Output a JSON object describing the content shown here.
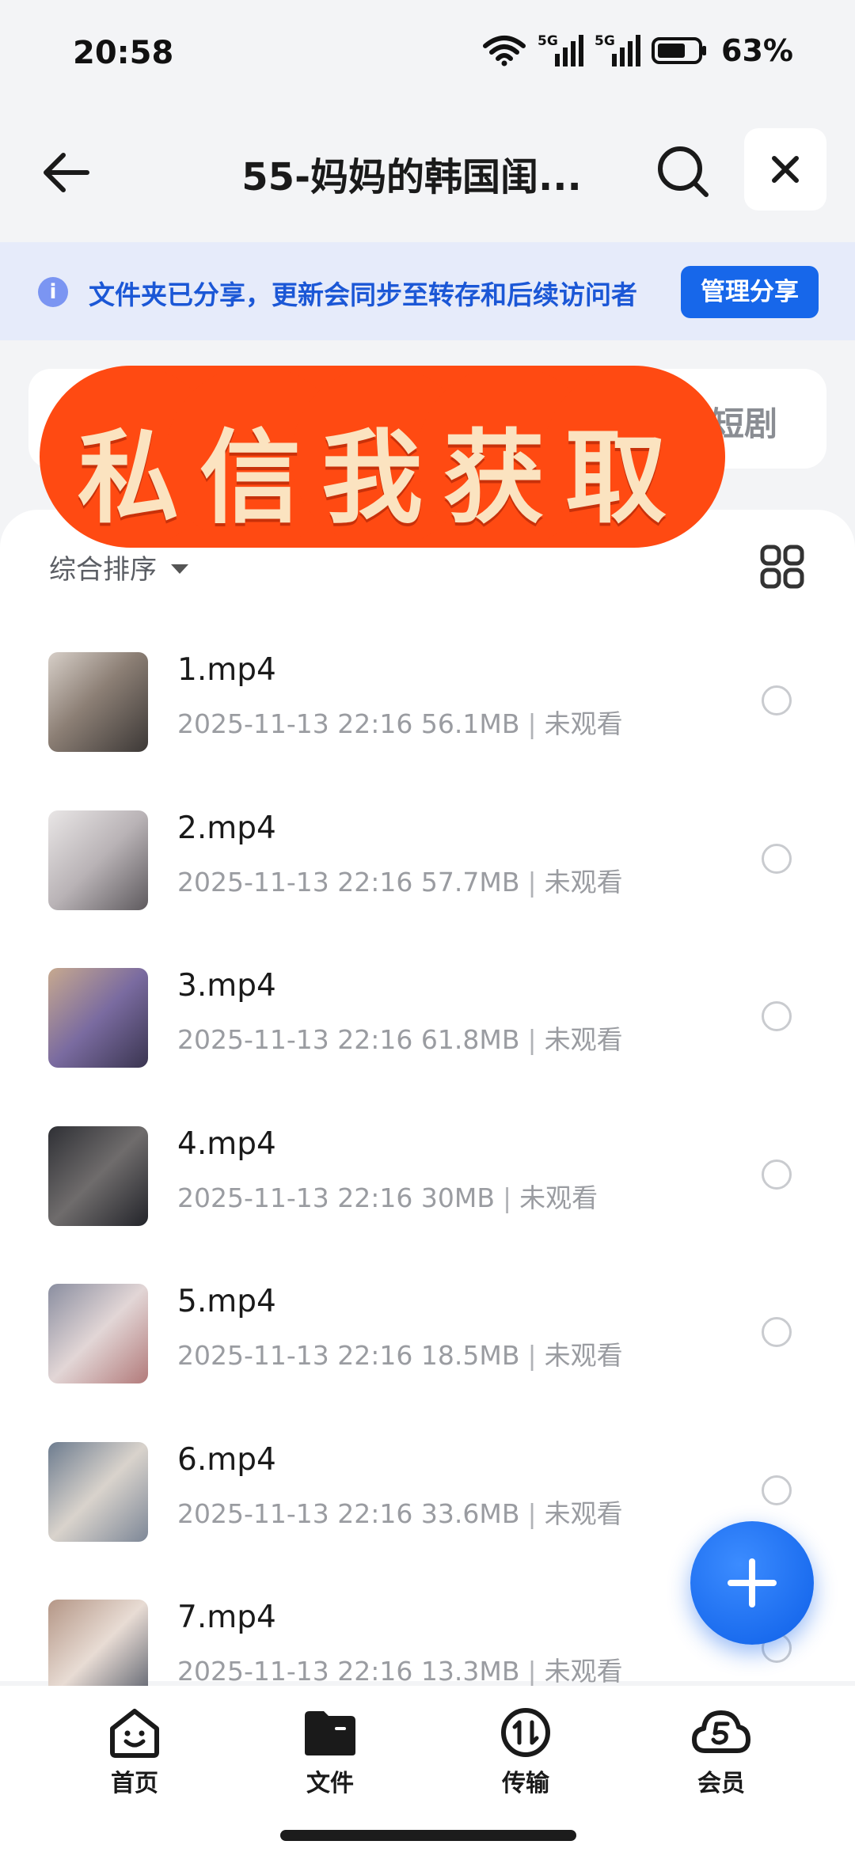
{
  "status_bar": {
    "time": "20:58",
    "battery": "63%",
    "network_1": "5G",
    "network_2": "5G"
  },
  "nav": {
    "title": "55-妈妈的韩国闺..."
  },
  "share_notice": {
    "text": "文件夹已分享，更新会同步至转存和后续访问者",
    "button": "管理分享"
  },
  "category_strip": {
    "visible_label": "短剧"
  },
  "promo": {
    "text": "私信我获取"
  },
  "list": {
    "sort_label": "综合排序",
    "files": [
      {
        "name": "1.mp4",
        "date": "2025-11-13 22:16",
        "size": "56.1MB",
        "status": "未观看"
      },
      {
        "name": "2.mp4",
        "date": "2025-11-13 22:16",
        "size": "57.7MB",
        "status": "未观看"
      },
      {
        "name": "3.mp4",
        "date": "2025-11-13 22:16",
        "size": "61.8MB",
        "status": "未观看"
      },
      {
        "name": "4.mp4",
        "date": "2025-11-13 22:16",
        "size": "30MB",
        "status": "未观看"
      },
      {
        "name": "5.mp4",
        "date": "2025-11-13 22:16",
        "size": "18.5MB",
        "status": "未观看"
      },
      {
        "name": "6.mp4",
        "date": "2025-11-13 22:16",
        "size": "33.6MB",
        "status": "未观看"
      },
      {
        "name": "7.mp4",
        "date": "2025-11-13 22:16",
        "size": "13.3MB",
        "status": "未观看"
      }
    ]
  },
  "tabbar": {
    "tabs": [
      {
        "label": "首页",
        "icon": "home-face-icon"
      },
      {
        "label": "文件",
        "icon": "folder-icon"
      },
      {
        "label": "传输",
        "icon": "transfer-icon"
      },
      {
        "label": "会员",
        "icon": "vip-cloud-icon"
      }
    ]
  },
  "colors": {
    "accent": "#1767ea",
    "notice_bg": "#e6ebfa",
    "promo": "#ff4a12",
    "promo_text": "#fbe3c0"
  }
}
